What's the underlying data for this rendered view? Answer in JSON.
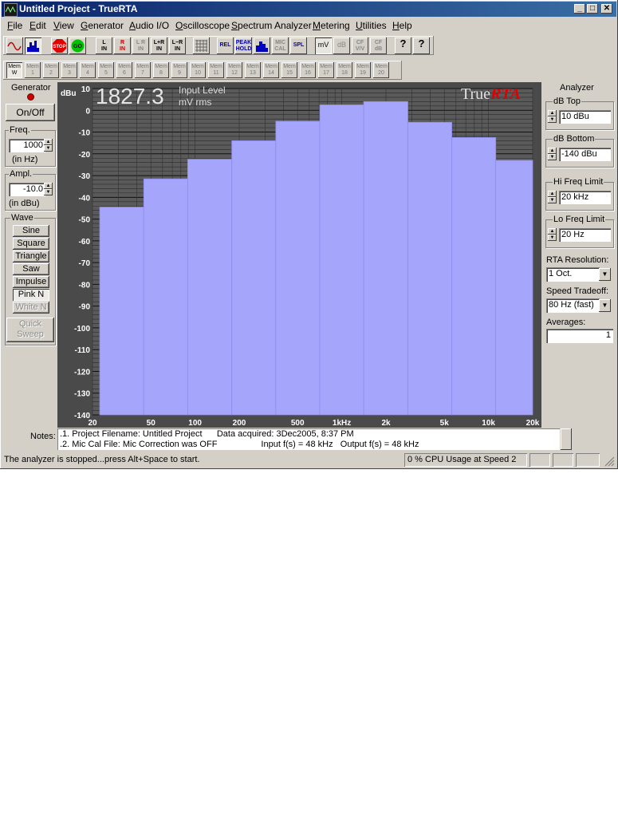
{
  "window": {
    "title": "Untitled Project - TrueRTA",
    "minimize": "_",
    "maximize": "□",
    "close": "✕"
  },
  "menu": [
    "File",
    "Edit",
    "View",
    "Generator",
    "Audio I/O",
    "Oscilloscope",
    "Spectrum Analyzer",
    "Metering",
    "Utilities",
    "Help"
  ],
  "toolbar": {
    "buttons": [
      {
        "name": "sine-wave-button",
        "label": "",
        "icon": "sine-wave-icon"
      },
      {
        "name": "spectrum-button",
        "label": "",
        "icon": "spectrum-icon"
      },
      {
        "name": "stop-button",
        "label": "STOP",
        "icon": "stop-icon"
      },
      {
        "name": "go-button",
        "label": "GO",
        "icon": "go-icon"
      },
      {
        "name": "l-in-button",
        "label": "L\nIN"
      },
      {
        "name": "r-in-button",
        "label": "R\nIN"
      },
      {
        "name": "lr-in-button",
        "label": "L R\nIN"
      },
      {
        "name": "l-plus-r-in-button",
        "label": "L+R\nIN"
      },
      {
        "name": "l-minus-r-in-button",
        "label": "L−R\nIN"
      },
      {
        "name": "grid-button",
        "label": "",
        "icon": "grid-icon"
      },
      {
        "name": "rel-button",
        "label": "REL"
      },
      {
        "name": "peak-hold-button",
        "label": "PEAK\nHOLD"
      },
      {
        "name": "bars-button",
        "label": "",
        "icon": "bars-icon"
      },
      {
        "name": "mic-cal-button",
        "label": "MIC\nCAL"
      },
      {
        "name": "spl-button",
        "label": "SPL"
      },
      {
        "name": "mv-button",
        "label": "mV"
      },
      {
        "name": "db-button",
        "label": "dB"
      },
      {
        "name": "cf-vv-button",
        "label": "CF\nV/V"
      },
      {
        "name": "cf-db-button",
        "label": "CF\ndB"
      },
      {
        "name": "help-button",
        "label": "?"
      },
      {
        "name": "context-help-button",
        "label": "?"
      }
    ],
    "mem_buttons": [
      "Mem\nW",
      "Mem\n1",
      "Mem\n2",
      "Mem\n3",
      "Mem\n4",
      "Mem\n5",
      "Mem\n6",
      "Mem\n7",
      "Mem\n8",
      "Mem\n9",
      "Mem\n10",
      "Mem\n11",
      "Mem\n12",
      "Mem\n13",
      "Mem\n14",
      "Mem\n15",
      "Mem\n16",
      "Mem\n17",
      "Mem\n18",
      "Mem\n19",
      "Mem\n20"
    ]
  },
  "generator": {
    "title": "Generator",
    "onoff": "On/Off",
    "freq_title": "Freq.",
    "freq_value": "1000",
    "freq_unit": "(in Hz)",
    "ampl_title": "Ampl.",
    "ampl_value": "-10.0",
    "ampl_unit": "(in dBu)",
    "wave_title": "Wave",
    "waves": [
      "Sine",
      "Square",
      "Triangle",
      "Saw",
      "Impulse",
      "Pink N",
      "White N"
    ],
    "quick_sweep": "Quick Sweep"
  },
  "analyzer": {
    "title": "Analyzer",
    "db_top_label": "dB Top",
    "db_top_value": "10 dBu",
    "db_bottom_label": "dB Bottom",
    "db_bottom_value": "-140 dBu",
    "hi_freq_label": "Hi Freq Limit",
    "hi_freq_value": "20 kHz",
    "lo_freq_label": "Lo Freq Limit",
    "lo_freq_value": "20 Hz",
    "resolution_label": "RTA Resolution:",
    "resolution_value": "1 Oct.",
    "speed_label": "Speed Tradeoff:",
    "speed_value": "80 Hz (fast)",
    "averages_label": "Averages:",
    "averages_value": "1"
  },
  "readout": {
    "value": "1827.3",
    "label1": "Input Level",
    "label2": "mV rms",
    "brand1": "True",
    "brand2": "RTA"
  },
  "chart_data": {
    "type": "bar",
    "ylabel": "dBu",
    "ylim": [
      -140,
      10
    ],
    "x_scale": "log",
    "xlim": [
      20,
      20000
    ],
    "y_ticks": [
      10,
      0,
      -10,
      -20,
      -30,
      -40,
      -50,
      -60,
      -70,
      -80,
      -90,
      -100,
      -110,
      -120,
      -130,
      -140
    ],
    "x_ticks": [
      {
        "label": "20",
        "value": 20
      },
      {
        "label": "50",
        "value": 50
      },
      {
        "label": "100",
        "value": 100
      },
      {
        "label": "200",
        "value": 200
      },
      {
        "label": "500",
        "value": 500
      },
      {
        "label": "1kHz",
        "value": 1000
      },
      {
        "label": "2k",
        "value": 2000
      },
      {
        "label": "5k",
        "value": 5000
      },
      {
        "label": "10k",
        "value": 10000
      },
      {
        "label": "20k",
        "value": 20000
      }
    ],
    "bands_hz": [
      [
        22.4,
        44.7
      ],
      [
        44.7,
        89.1
      ],
      [
        89.1,
        178
      ],
      [
        178,
        355
      ],
      [
        355,
        708
      ],
      [
        708,
        1410
      ],
      [
        1410,
        2820
      ],
      [
        2820,
        5620
      ],
      [
        5620,
        11200
      ],
      [
        11200,
        20000
      ]
    ],
    "values": [
      -44.5,
      -31.5,
      -22.5,
      -14,
      -5,
      2.5,
      4,
      -5.5,
      -12.5,
      -23
    ],
    "grid": true,
    "bar_color": "#a5a5fc"
  },
  "notes": {
    "label": "Notes:",
    "line1": ".1. Project Filename: Untitled Project      Data acquired: 3Dec2005, 8:37 PM",
    "line2": ".2. Mic Cal File: Mic Correction was OFF                  Input f(s) = 48 kHz   Output f(s) = 48 kHz"
  },
  "status": {
    "message": "The analyzer is stopped...press Alt+Space to start.",
    "cpu": "0 % CPU Usage at Speed 2"
  }
}
